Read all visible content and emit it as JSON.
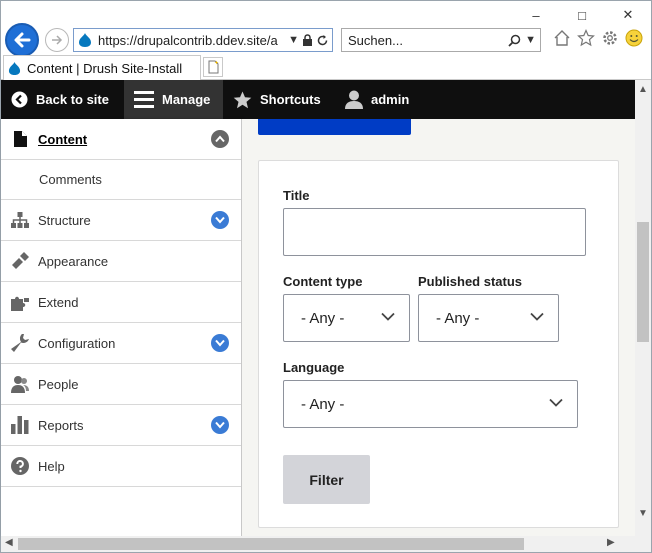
{
  "browser": {
    "url": "https://drupalcontrib.ddev.site/ad",
    "search_placeholder": "Suchen...",
    "tab_title": "Content | Drush Site-Install",
    "window_controls": [
      "–",
      "□",
      "✕"
    ]
  },
  "toolbar": {
    "back_label": "Back to site",
    "manage_label": "Manage",
    "shortcuts_label": "Shortcuts",
    "user_label": "admin"
  },
  "sidebar": {
    "items": [
      {
        "label": "Content",
        "icon": "file-icon",
        "active": true
      },
      {
        "label": "Comments"
      },
      {
        "label": "Structure",
        "icon": "sitemap-icon"
      },
      {
        "label": "Appearance",
        "icon": "paintbrush-icon"
      },
      {
        "label": "Extend",
        "icon": "puzzle-icon"
      },
      {
        "label": "Configuration",
        "icon": "wrench-icon"
      },
      {
        "label": "People",
        "icon": "people-icon"
      },
      {
        "label": "Reports",
        "icon": "bar-chart-icon"
      },
      {
        "label": "Help",
        "icon": "help-icon"
      }
    ]
  },
  "filters": {
    "title_label": "Title",
    "title_value": "",
    "content_type_label": "Content type",
    "content_type_value": "- Any -",
    "published_label": "Published status",
    "published_value": "- Any -",
    "language_label": "Language",
    "language_value": "- Any -",
    "filter_button": "Filter"
  },
  "colors": {
    "toolbar_bg": "#0f0f0f",
    "accent_blue": "#003cc5",
    "toggle_blue": "#3a7bd5"
  }
}
